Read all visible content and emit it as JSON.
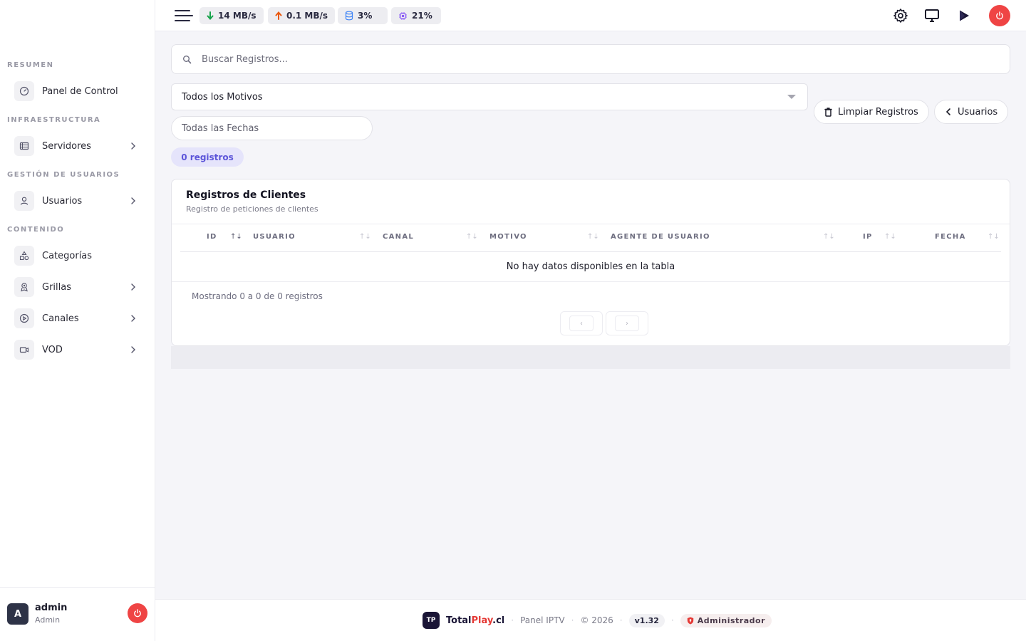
{
  "sidebar": {
    "sections": [
      {
        "title": "RESUMEN",
        "items": [
          {
            "label": "Panel de Control",
            "icon": "gauge-icon",
            "has_children": false
          }
        ]
      },
      {
        "title": "INFRAESTRUCTURA",
        "items": [
          {
            "label": "Servidores",
            "icon": "server-icon",
            "has_children": true
          }
        ]
      },
      {
        "title": "GESTIÓN DE USUARIOS",
        "items": [
          {
            "label": "Usuarios",
            "icon": "user-icon",
            "has_children": true
          }
        ]
      },
      {
        "title": "CONTENIDO",
        "items": [
          {
            "label": "Categorías",
            "icon": "shapes-icon",
            "has_children": false
          },
          {
            "label": "Grillas",
            "icon": "grid-badge-icon",
            "has_children": true
          },
          {
            "label": "Canales",
            "icon": "play-circle-icon",
            "has_children": true
          },
          {
            "label": "VOD",
            "icon": "video-camera-icon",
            "has_children": true
          }
        ]
      }
    ],
    "user": {
      "initial": "A",
      "name": "admin",
      "role": "Admin"
    }
  },
  "topbar": {
    "stats": [
      {
        "icon": "arrow-down-icon",
        "value": "14 MB/s",
        "color": "#16a34a"
      },
      {
        "icon": "arrow-up-icon",
        "value": "0.1 MB/s",
        "color": "#ea580c"
      },
      {
        "icon": "database-icon",
        "value": "3%",
        "color": "#3b82f6"
      },
      {
        "icon": "cpu-icon",
        "value": "21%",
        "color": "#8b5cf6"
      }
    ],
    "actions": [
      "gear-icon",
      "monitor-icon",
      "play-icon",
      "power-icon"
    ]
  },
  "filters": {
    "search_placeholder": "Buscar Registros...",
    "motivo_selected": "Todos los Motivos",
    "date_placeholder": "Todas las Fechas",
    "clear_button": "Limpiar Registros",
    "back_button": "Usuarios",
    "count_badge": "0 registros"
  },
  "card": {
    "title": "Registros de Clientes",
    "subtitle": "Registro de peticiones de clientes",
    "columns": [
      "ID",
      "USUARIO",
      "CANAL",
      "MOTIVO",
      "AGENTE DE USUARIO",
      "IP",
      "FECHA"
    ],
    "empty_text": "No hay datos disponibles en la tabla",
    "info_text": "Mostrando 0 a 0 de 0 registros",
    "prev_label": "‹",
    "next_label": "›"
  },
  "footer": {
    "logo_text": "TP",
    "brand_main": "Total",
    "brand_accent": "Play",
    "brand_tld": ".cl",
    "panel_label": "Panel IPTV",
    "copyright": "© 2026",
    "version": "v1.32",
    "role": "Administrador",
    "accent_color": "#e53935"
  },
  "colors": {
    "accent": "#5c55d9",
    "danger": "#ef4444",
    "badge_bg": "#e5e4fb"
  }
}
